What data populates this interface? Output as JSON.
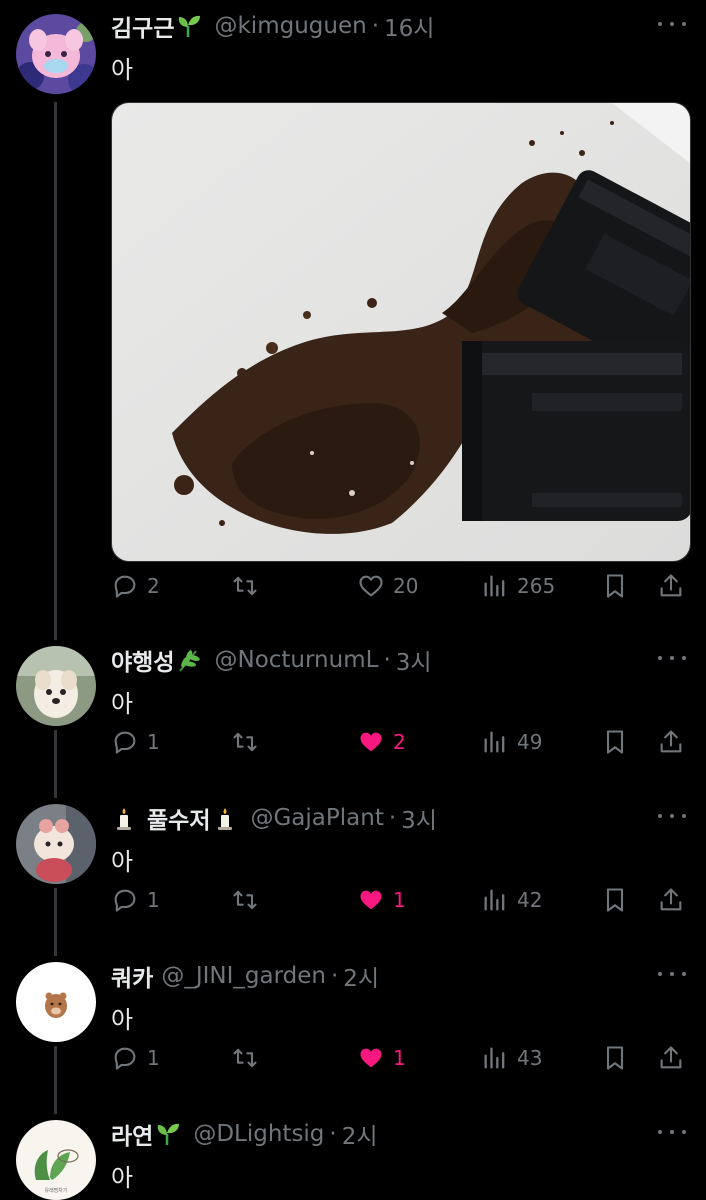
{
  "tweets": [
    {
      "name": "김구근",
      "name_emoji": "seedling",
      "handle": "@kimguguen",
      "separator": "·",
      "time": "16시",
      "text": "아",
      "has_media": true,
      "avatar": "pink-plush-character",
      "replies": "2",
      "retweets": "",
      "likes": "20",
      "liked": false,
      "views": "265"
    },
    {
      "name": "야행성",
      "name_emoji": "herb",
      "handle": "@NocturnumL",
      "separator": "·",
      "time": "3시",
      "text": "아",
      "avatar": "white-dog",
      "replies": "1",
      "retweets": "",
      "likes": "2",
      "liked": true,
      "views": "49"
    },
    {
      "name": "풀수저",
      "name_emoji": "candle",
      "handle": "@GajaPlant",
      "separator": "·",
      "time": "3시",
      "text": "아",
      "avatar": "plush-doll",
      "replies": "1",
      "retweets": "",
      "likes": "1",
      "liked": true,
      "views": "42"
    },
    {
      "name": "쿼카",
      "handle": "@_JINI_garden",
      "separator": "·",
      "time": "2시",
      "text": "아",
      "avatar": "quokka",
      "replies": "1",
      "retweets": "",
      "likes": "1",
      "liked": true,
      "views": "43"
    },
    {
      "name": "라연",
      "name_emoji": "seedling",
      "handle": "@DLightsig",
      "separator": "·",
      "time": "2시",
      "text": "아",
      "avatar": "plant-drawing",
      "avatar_caption": "유래명차기",
      "replies": "",
      "retweets": "",
      "likes": "",
      "liked": false,
      "views": ""
    }
  ],
  "colors": {
    "background": "#000000",
    "text": "#e7e9ea",
    "muted": "#71767b",
    "like": "#f91880",
    "thread_line": "#333639"
  },
  "icons": [
    "reply-icon",
    "retweet-icon",
    "heart-icon",
    "views-icon",
    "bookmark-icon",
    "share-icon",
    "more-icon"
  ]
}
